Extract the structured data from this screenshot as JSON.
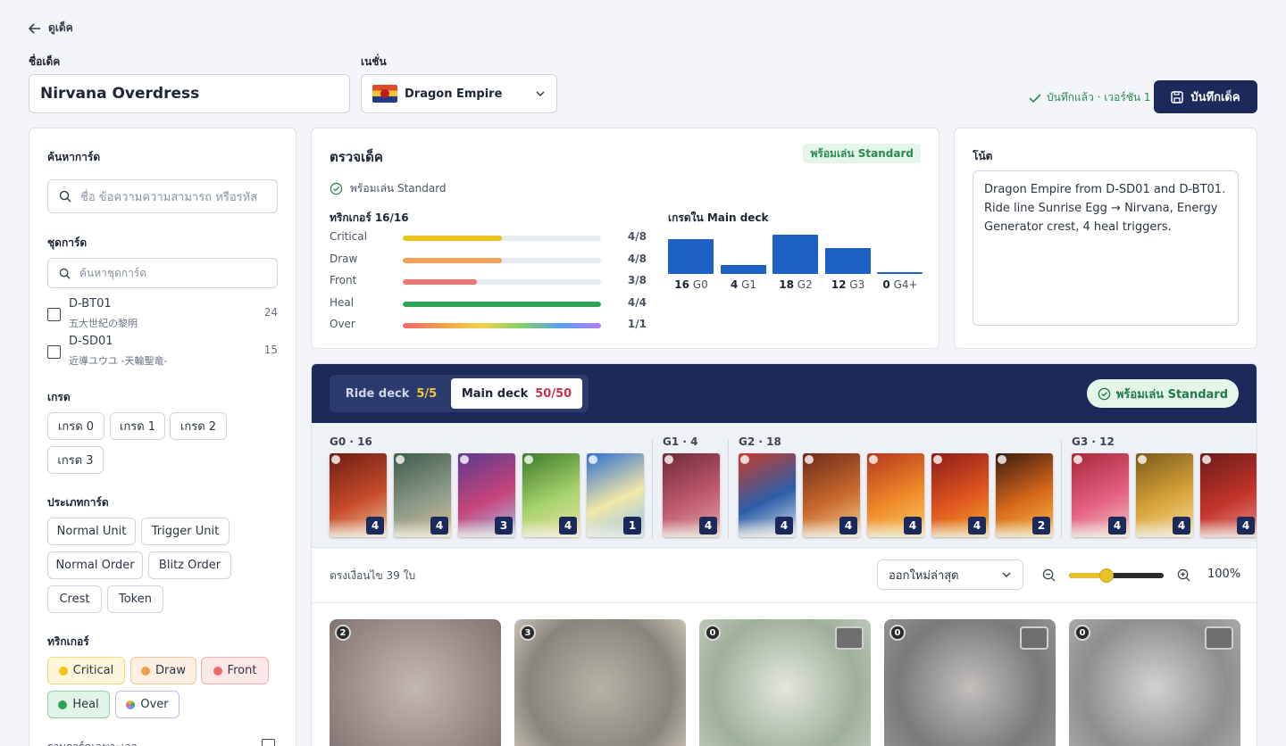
{
  "header": {
    "back_label": "ดูเด็ค",
    "deck_name_label": "ชื่อเด็ค",
    "deck_name": "Nirvana Overdress",
    "nation_label": "เนชั่น",
    "nation": "Dragon Empire",
    "saved_status": "บันทึกแล้ว · เวอร์ชัน 1",
    "save_button": "บันทึกเด็ค"
  },
  "filters": {
    "search_title": "ค้นหาการ์ด",
    "search_placeholder": "ชื่อ ข้อความความสามารถ หรือรหัส",
    "set_title": "ชุดการ์ด",
    "set_search_placeholder": "ค้นหาชุดการ์ด",
    "sets": [
      {
        "code": "D-BT01",
        "name": "五大世紀の黎明",
        "count": "24"
      },
      {
        "code": "D-SD01",
        "name": "近導ユウユ -天輪聖竜-",
        "count": "15"
      }
    ],
    "grade_title": "เกรด",
    "grades": [
      "เกรด 0",
      "เกรด 1",
      "เกรด 2",
      "เกรด 3"
    ],
    "type_title": "ประเภทการ์ด",
    "types": [
      "Normal Unit",
      "Trigger Unit",
      "Normal Order",
      "Blitz Order",
      "Crest",
      "Token"
    ],
    "trigger_title": "ทริกเกอร์",
    "triggers": [
      {
        "label": "Critical",
        "color": "#f0c419",
        "bg": "#fdf6d8"
      },
      {
        "label": "Draw",
        "color": "#f0a04b",
        "bg": "#fdf0e2"
      },
      {
        "label": "Front",
        "color": "#ee6a6a",
        "bg": "#fde8e8"
      },
      {
        "label": "Heal",
        "color": "#2ea35a",
        "bg": "#e1f4e8"
      },
      {
        "label": "Over",
        "color": "#7b8df0",
        "bg": "#ffffff"
      }
    ],
    "more_label": "รวมการ์ดเฉพาะเวล"
  },
  "check": {
    "title": "ตรวจเด็ค",
    "badge": "พร้อมเล่น Standard",
    "status": "พร้อมเล่น Standard",
    "triggers_title": "ทริกเกอร์ 16/16",
    "triggers": [
      {
        "name": "Critical",
        "value": "4/8",
        "fraction": 0.5,
        "color": "#ebc21f"
      },
      {
        "name": "Draw",
        "value": "4/8",
        "fraction": 0.5,
        "color": "#eea25a"
      },
      {
        "name": "Front",
        "value": "3/8",
        "fraction": 0.375,
        "color": "#ef7474"
      },
      {
        "name": "Heal",
        "value": "4/4",
        "fraction": 1.0,
        "color": "#2ea35a"
      },
      {
        "name": "Over",
        "value": "1/1",
        "fraction": 1.0,
        "color": "rainbow"
      }
    ],
    "grades_title": "เกรดใน Main deck",
    "grades": [
      {
        "count": "16",
        "label": "G0",
        "value": 16
      },
      {
        "count": "4",
        "label": "G1",
        "value": 4
      },
      {
        "count": "18",
        "label": "G2",
        "value": 18
      },
      {
        "count": "12",
        "label": "G3",
        "value": 12
      },
      {
        "count": "0",
        "label": "G4+",
        "value": 0
      }
    ]
  },
  "notes": {
    "title": "โน้ต",
    "text": "Dragon Empire from D-SD01 and D-BT01. Ride line Sunrise Egg → Nirvana, Energy Generator crest, 4 heal triggers."
  },
  "deck": {
    "tabs": [
      {
        "label": "Ride deck",
        "count": "5/5",
        "active": false
      },
      {
        "label": "Main deck",
        "count": "50/50",
        "active": true
      }
    ],
    "standard_pill": "พร้อมเล่น Standard",
    "groups": [
      {
        "label": "G0 · 16",
        "cards": [
          {
            "count": "4",
            "colors": [
              "#6b1e14",
              "#c64a2a",
              "#efc9a0"
            ]
          },
          {
            "count": "4",
            "colors": [
              "#3d5a4b",
              "#8c9a8a",
              "#d8c08c"
            ]
          },
          {
            "count": "3",
            "colors": [
              "#5b3a8e",
              "#c7447a",
              "#a8c6ea"
            ]
          },
          {
            "count": "4",
            "colors": [
              "#3d7a2a",
              "#a6d36c",
              "#f3e3a5"
            ]
          },
          {
            "count": "1",
            "colors": [
              "#2b6fcf",
              "#f2e7a9",
              "#8ec5ee"
            ]
          }
        ]
      },
      {
        "label": "G1 · 4",
        "cards": [
          {
            "count": "4",
            "colors": [
              "#6e2a3a",
              "#c05a6e",
              "#e4a8a8"
            ]
          }
        ]
      },
      {
        "label": "G2 · 18",
        "cards": [
          {
            "count": "4",
            "colors": [
              "#c93a2a",
              "#2c5fa8",
              "#e0e4ec"
            ]
          },
          {
            "count": "4",
            "colors": [
              "#6b2a1a",
              "#c96a2c",
              "#f3d2a0"
            ]
          },
          {
            "count": "4",
            "colors": [
              "#b3381c",
              "#f08a2a",
              "#f6d36a"
            ]
          },
          {
            "count": "4",
            "colors": [
              "#8c1c1c",
              "#e0561e",
              "#f0b030"
            ]
          },
          {
            "count": "2",
            "colors": [
              "#3a1a10",
              "#d96a1a",
              "#f6c04a"
            ]
          }
        ]
      },
      {
        "label": "G3 · 12",
        "cards": [
          {
            "count": "4",
            "colors": [
              "#a8283a",
              "#e46080",
              "#f4c6c6"
            ]
          },
          {
            "count": "4",
            "colors": [
              "#7a5a1a",
              "#d9a43a",
              "#f3e0a0"
            ]
          },
          {
            "count": "4",
            "colors": [
              "#6a1a1a",
              "#c2342a",
              "#e89090"
            ]
          }
        ]
      }
    ],
    "result_count": "ตรงเงื่อนไข 39 ใบ",
    "sort": "ออกใหม่ล่าสุด",
    "zoom": "100%",
    "zoom_fraction": 0.4,
    "results": [
      {
        "grade": "2",
        "trigger": false,
        "colors": [
          "#9a8a86",
          "#c4b8b2",
          "#7a6e6a"
        ]
      },
      {
        "grade": "3",
        "trigger": false,
        "colors": [
          "#8a857c",
          "#b8b2a6",
          "#d9d2c4"
        ]
      },
      {
        "grade": "0",
        "trigger": true,
        "colors": [
          "#9fb09a",
          "#e2e8dc",
          "#c4cfbf"
        ]
      },
      {
        "grade": "0",
        "trigger": true,
        "colors": [
          "#7a7a7a",
          "#c2bfbd",
          "#9a9897"
        ]
      },
      {
        "grade": "0",
        "trigger": true,
        "colors": [
          "#8e8e8e",
          "#d2d2d2",
          "#b0b0b0"
        ]
      }
    ]
  }
}
